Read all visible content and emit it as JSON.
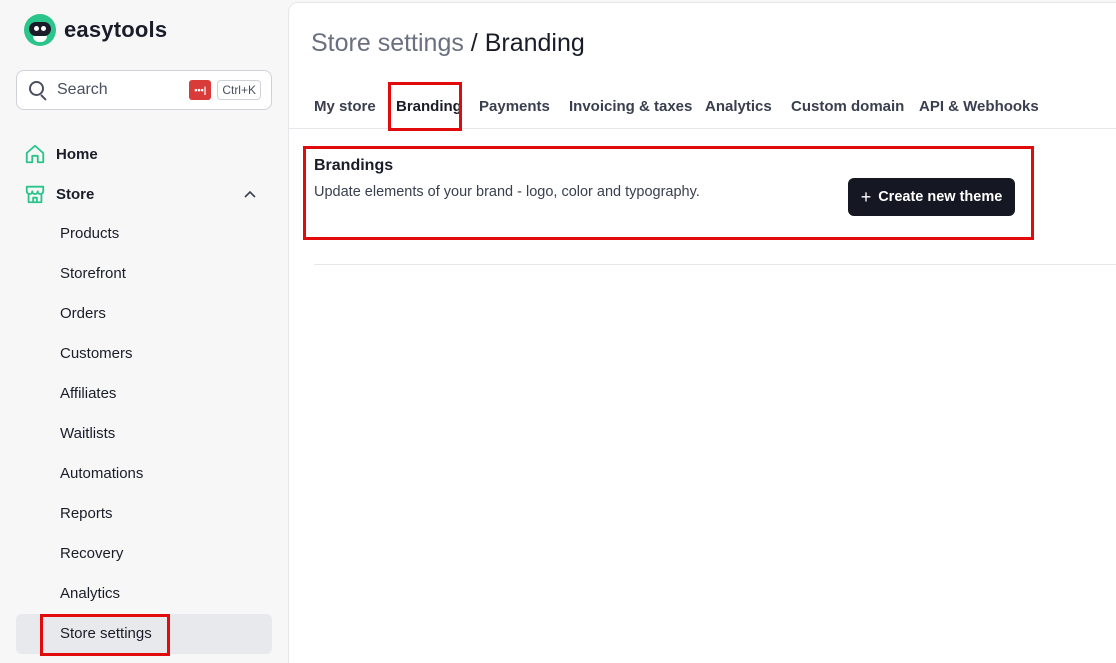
{
  "brand": {
    "name": "easytools"
  },
  "search": {
    "placeholder": "Search",
    "shortcut": "Ctrl+K",
    "password_badge": "•••|"
  },
  "sidebar": {
    "home": "Home",
    "store": "Store",
    "store_items": [
      "Products",
      "Storefront",
      "Orders",
      "Customers",
      "Affiliates",
      "Waitlists",
      "Automations",
      "Reports",
      "Recovery",
      "Analytics",
      "Store settings"
    ],
    "active_item": "Store settings"
  },
  "header": {
    "breadcrumb_parent": "Store settings",
    "separator": " / ",
    "current": "Branding"
  },
  "tabs": [
    {
      "label": "My store"
    },
    {
      "label": "Branding",
      "active": true
    },
    {
      "label": "Payments"
    },
    {
      "label": "Invoicing & taxes"
    },
    {
      "label": "Analytics"
    },
    {
      "label": "Custom domain"
    },
    {
      "label": "API & Webhooks"
    }
  ],
  "brandings": {
    "title": "Brandings",
    "description": "Update elements of your brand - logo, color and typography.",
    "create_button": "Create new theme"
  },
  "colors": {
    "accent": "#2bc48a",
    "dark_button": "#151823",
    "highlight": "#e20b0b",
    "active_nav": "#e8e9ec"
  }
}
